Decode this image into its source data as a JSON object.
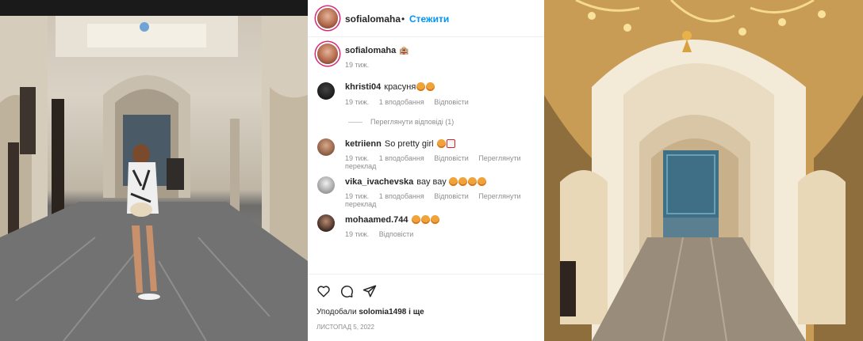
{
  "post": {
    "author": "sofialomaha",
    "follow_separator": "•",
    "follow_label": "Стежити",
    "caption_emoji": "🏨",
    "caption_time": "19 тиж."
  },
  "comments": [
    {
      "user": "khristi04",
      "text": "красуня",
      "emojis": 2,
      "time": "19 тиж.",
      "likes": "1 вподобання",
      "reply": "Відповісти",
      "translate": ""
    },
    {
      "user": "ketriienn",
      "text": "So pretty girl",
      "emojis": 2,
      "time": "19 тиж.",
      "likes": "1 вподобання",
      "reply": "Відповісти",
      "translate": "Переглянути переклад"
    },
    {
      "user": "vika_ivachevska",
      "text": "вау вау",
      "emojis": 4,
      "time": "19 тиж.",
      "likes": "1 вподобання",
      "reply": "Відповісти",
      "translate": "Переглянути переклад"
    },
    {
      "user": "mohaamed.744",
      "text": "",
      "emojis": 3,
      "time": "19 тиж.",
      "likes": "",
      "reply": "Відповісти",
      "translate": ""
    }
  ],
  "view_replies": "Переглянути відповіді (1)",
  "likes_line": {
    "prefix": "Уподобали",
    "user": "solomia1498",
    "suffix": "і ще"
  },
  "date": "ЛИСТОПАД 5, 2022",
  "icons": [
    "heart-icon",
    "comment-icon",
    "share-icon"
  ],
  "colors": {
    "follow": "#0095f6",
    "meta": "#8e8e8e",
    "text": "#262626"
  }
}
